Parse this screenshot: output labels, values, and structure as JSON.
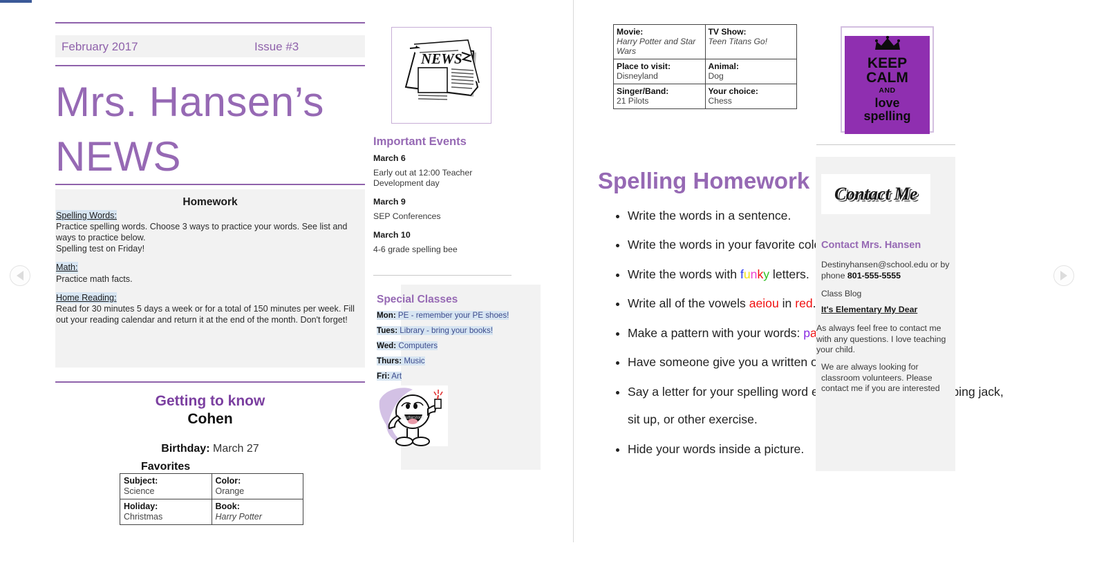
{
  "newsletter": {
    "issue_bar": {
      "date": "February 2017",
      "issue": "Issue #3"
    },
    "masthead_line1": "Mrs. Hansen’s",
    "masthead_line2": "NEWS",
    "accent_color": "#9669b4",
    "highlight_color": "#d7e5f2"
  },
  "homework": {
    "title": "Homework",
    "sections": [
      {
        "heading": "Spelling Words:",
        "body": "Practice spelling words.  Choose 3 ways to practice your words. See list and ways to practice below.\nSpelling test on Friday!"
      },
      {
        "heading": "Math:",
        "body": "Practice math facts."
      },
      {
        "heading": "Home Reading:",
        "body": "Read for 30 minutes 5 days a week or for a total of 150 minutes per week. Fill out your reading calendar and return it at the end of the month. Don't forget!"
      }
    ]
  },
  "getting_to_know": {
    "title": "Getting to know",
    "name": "Cohen",
    "birthday_label": "Birthday:",
    "birthday_value": "March 27",
    "favorites_label": "Favorites",
    "favorites": [
      [
        {
          "key": "Subject:",
          "value": "Science",
          "italic": false
        },
        {
          "key": "Color:",
          "value": "Orange",
          "italic": false
        }
      ],
      [
        {
          "key": "Holiday:",
          "value": "Christmas",
          "italic": false
        },
        {
          "key": "Book:",
          "value": "Harry Potter",
          "italic": true
        }
      ]
    ]
  },
  "news_image": {
    "alt": "newspaper-clipart",
    "headline": "NEWS"
  },
  "important_events": {
    "title": "Important Events",
    "events": [
      {
        "date": "March 6",
        "desc": "Early out at 12:00 Teacher Development day"
      },
      {
        "date": "March 9",
        "desc": "SEP Conferences"
      },
      {
        "date": "March 10",
        "desc": "4-6 grade spelling bee"
      }
    ]
  },
  "special_classes": {
    "title": "Special Classes",
    "rows": [
      {
        "day": "Mon:",
        "value": "PE - remember your PE shoes!"
      },
      {
        "day": "Tues:",
        "value": "Library - bring your books!"
      },
      {
        "day": "Wed:",
        "value": "Computers"
      },
      {
        "day": "Thurs:",
        "value": "Music"
      },
      {
        "day": "Fri:",
        "value": "Art"
      }
    ],
    "image_alt": "cartoon-kid-clipart"
  },
  "favorites_top": [
    [
      {
        "key": "Movie:",
        "value": "Harry Potter and Star Wars",
        "italic": true
      },
      {
        "key": "TV Show:",
        "value": "Teen Titans Go!",
        "italic": true
      }
    ],
    [
      {
        "key": "Place to visit:",
        "value": "Disneyland",
        "italic": false
      },
      {
        "key": "Animal:",
        "value": "Dog",
        "italic": false
      }
    ],
    [
      {
        "key": "Singer/Band:",
        "value": "21 Pilots",
        "italic": false
      },
      {
        "key": "Your choice:",
        "value": "Chess",
        "italic": false
      }
    ]
  ],
  "spelling_homework": {
    "title": "Spelling Homework",
    "items": [
      "Write the words in a sentence.",
      "Write the words in your favorite colors.",
      "Write the words with funky letters.",
      "Write all of the vowels aeiou in red.",
      "Make a pattern with your words: pattern.",
      "Have someone give you a written or verbal practice test.",
      "Say a letter for your spelling word each time you finish a jumping jack, sit up, or other exercise.",
      "Hide your words inside a picture."
    ],
    "colored_words": {
      "funky": [
        {
          "ch": "f",
          "color": "#2a3bf0"
        },
        {
          "ch": "u",
          "color": "#f2e413"
        },
        {
          "ch": "n",
          "color": "#ef3fd0"
        },
        {
          "ch": "k",
          "color": "#f01010"
        },
        {
          "ch": "y",
          "color": "#30c020"
        }
      ],
      "aeiou_color": "#f01010",
      "red_color": "#f01010",
      "pattern": [
        {
          "ch": "p",
          "color": "#8a2be2"
        },
        {
          "ch": "a",
          "color": "#f01010"
        },
        {
          "ch": "t",
          "color": "#8a2be2"
        },
        {
          "ch": "t",
          "color": "#f01010"
        },
        {
          "ch": "e",
          "color": "#8a2be2"
        },
        {
          "ch": "r",
          "color": "#f01010"
        },
        {
          "ch": "n",
          "color": "#8a2be2"
        }
      ]
    }
  },
  "keep_calm": {
    "line_keep": "KEEP",
    "line_calm": "CALM",
    "line_and": "AND",
    "line_1": "love",
    "line_2": "spelling",
    "bg_color": "#8f2fb0"
  },
  "contact": {
    "image_text": "Contact Me",
    "title": "Contact Mrs. Hansen",
    "email_prefix": "Destinyhansen@school.edu or by phone ",
    "phone": "801-555-5555",
    "blog_label": "Class Blog",
    "blog_link": "It's Elementary My Dear",
    "paragraph_1": "As always feel free to    contact me with any questions. I love teaching your child.",
    "paragraph_2": "We are always looking for classroom volunteers. Please contact me if you are interested"
  },
  "nav": {
    "prev": "◀",
    "next": "▶"
  }
}
